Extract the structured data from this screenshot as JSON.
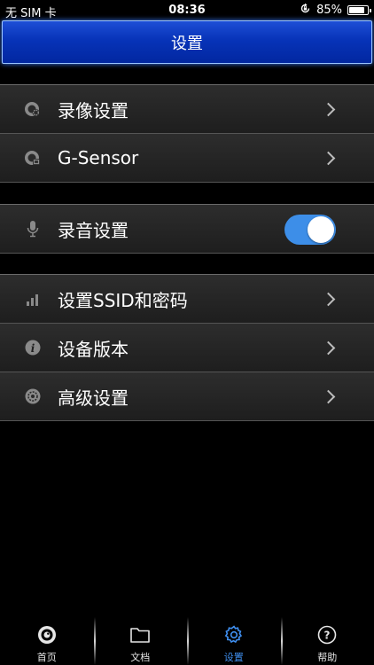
{
  "status_bar": {
    "carrier": "无 SIM 卡",
    "time": "08:36",
    "battery_percent": "85%",
    "battery_level": 0.85
  },
  "header": {
    "title": "设置"
  },
  "groups": [
    {
      "rows": [
        {
          "label": "录像设置",
          "icon": "video-settings-icon",
          "control": "chevron"
        },
        {
          "label": "G-Sensor",
          "icon": "g-sensor-icon",
          "control": "chevron"
        }
      ]
    },
    {
      "rows": [
        {
          "label": "录音设置",
          "icon": "microphone-icon",
          "control": "toggle",
          "toggle_on": true
        }
      ]
    },
    {
      "rows": [
        {
          "label": "设置SSID和密码",
          "icon": "signal-bars-icon",
          "control": "chevron"
        },
        {
          "label": "设备版本",
          "icon": "info-icon",
          "control": "chevron"
        },
        {
          "label": "高级设置",
          "icon": "advanced-gear-icon",
          "control": "chevron"
        }
      ]
    }
  ],
  "tab_bar": {
    "tabs": [
      {
        "label": "首页",
        "icon": "home-camera-icon",
        "active": false
      },
      {
        "label": "文档",
        "icon": "folder-icon",
        "active": false
      },
      {
        "label": "设置",
        "icon": "settings-gear-icon",
        "active": true
      },
      {
        "label": "帮助",
        "icon": "help-icon",
        "active": false
      }
    ]
  },
  "colors": {
    "header_blue": "#0733b8",
    "toggle_on": "#3d8ee8",
    "tab_active": "#3f8ff0"
  }
}
